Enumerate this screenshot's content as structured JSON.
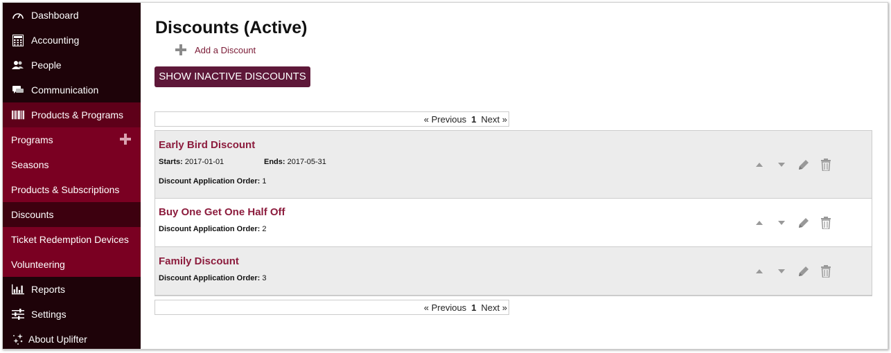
{
  "sidebar": {
    "items": [
      {
        "label": "Dashboard",
        "icon": "dashboard-icon"
      },
      {
        "label": "Accounting",
        "icon": "calculator-icon"
      },
      {
        "label": "People",
        "icon": "people-icon"
      },
      {
        "label": "Communication",
        "icon": "chat-icon"
      },
      {
        "label": "Products & Programs",
        "icon": "barcode-icon"
      },
      {
        "label": "Programs"
      },
      {
        "label": "Seasons"
      },
      {
        "label": "Products & Subscriptions"
      },
      {
        "label": "Discounts"
      },
      {
        "label": "Ticket Redemption Devices"
      },
      {
        "label": "Volunteering"
      },
      {
        "label": "Reports",
        "icon": "bar-chart-icon"
      },
      {
        "label": "Settings",
        "icon": "sliders-icon"
      },
      {
        "label": "About Uplifter",
        "icon": "stars-icon"
      }
    ]
  },
  "main": {
    "title": "Discounts (Active)",
    "add_label": "Add a Discount",
    "show_inactive_label": "SHOW INACTIVE DISCOUNTS",
    "pager": {
      "prev": "« Previous",
      "page": "1",
      "next": "Next »"
    },
    "discounts": [
      {
        "name": "Early Bird Discount",
        "starts_label": "Starts:",
        "starts": "2017-01-01",
        "ends_label": "Ends:",
        "ends": "2017-05-31",
        "order_label": "Discount Application Order:",
        "order": "1"
      },
      {
        "name": "Buy One Get One Half Off",
        "order_label": "Discount Application Order:",
        "order": "2"
      },
      {
        "name": "Family Discount",
        "order_label": "Discount Application Order:",
        "order": "3"
      }
    ]
  },
  "colors": {
    "sidebar": "#1e0309",
    "active_parent": "#5e0019",
    "submenu": "#7a0022",
    "submenu_selected": "#3d000f",
    "accent": "#8c1c3d",
    "button": "#5e1839"
  }
}
